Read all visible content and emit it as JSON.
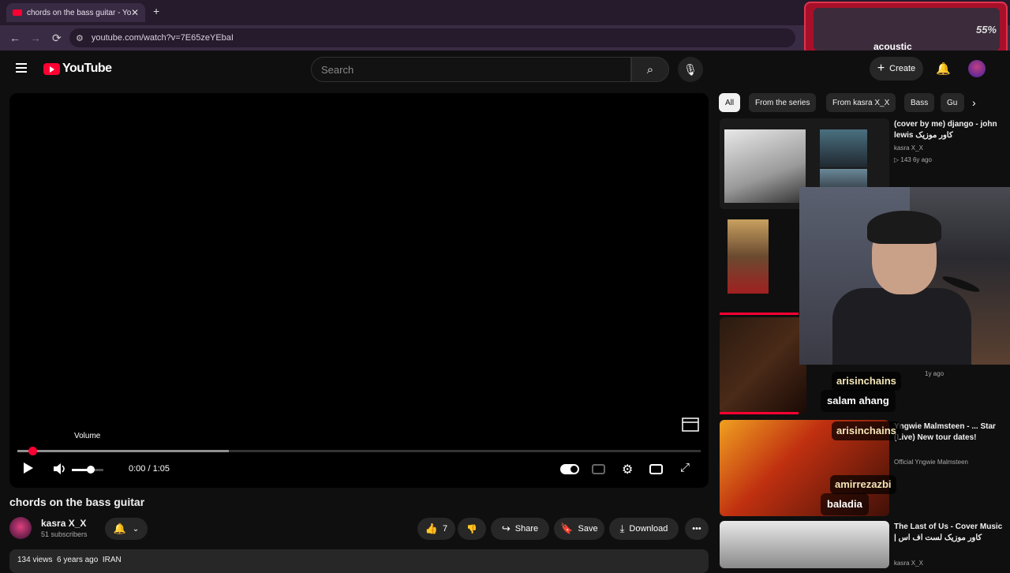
{
  "browser": {
    "tab_title": "chords on the bass guitar - YouTube",
    "tab_close": "✕",
    "new_tab": "+",
    "url": "youtube.com/watch?v=7E65zeYEbaI",
    "back": "←",
    "forward": "→",
    "reload": "⟳"
  },
  "widget": {
    "percent": "55%",
    "label": "acoustic"
  },
  "header": {
    "logo_text": "YouTube",
    "search_placeholder": "Search",
    "create_label": "Create"
  },
  "player": {
    "volume_tooltip": "Volume",
    "time": "0:00 / 1:05",
    "progress_fraction": 0.003,
    "buffer_fraction": 0.31,
    "volume_fraction": 0.6
  },
  "video": {
    "title": "chords on the bass guitar",
    "channel_name": "kasra X_X",
    "subscribers": "51 subscribers",
    "likes": "7",
    "share_label": "Share",
    "save_label": "Save",
    "download_label": "Download",
    "meta": "134 views  6 years ago  IRAN"
  },
  "chips": [
    "All",
    "From the series",
    "From kasra X_X",
    "Bass",
    "Gu"
  ],
  "recommendations": [
    {
      "title": "(cover by me) django - john lewis کاور موزیک",
      "channel": "kasra X_X",
      "stats": "▷ 143   6y ago"
    },
    {
      "title": "",
      "channel": "",
      "stats": "1y ago"
    },
    {
      "title": "Yngwie Malmsteen - ... Star (Live) New tour dates!",
      "channel": "Official Yngwie Malmsteen",
      "stats": ""
    },
    {
      "title": "The Last of Us - Cover Music | کاور موزیک لست اف اس",
      "channel": "kasra X_X",
      "stats": ""
    }
  ],
  "chat": {
    "name1": "arisinchains",
    "msg1": "salam ahang",
    "name2": "arisinchains",
    "name3": "amirrezazbi",
    "msg3": "baladia"
  },
  "colors": {
    "accent": "#ff0033",
    "background": "#0f0f0f",
    "pill": "#272727"
  }
}
